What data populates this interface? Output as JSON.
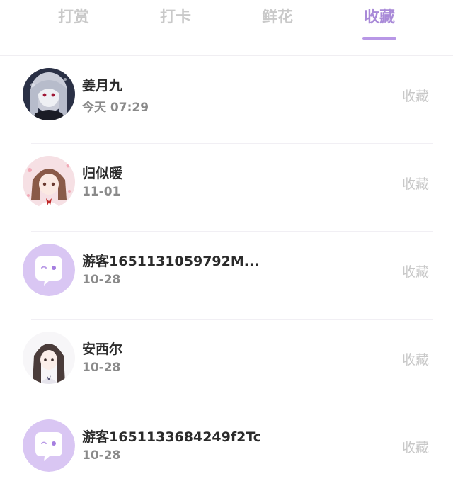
{
  "tabs": [
    {
      "label": "打赏",
      "active": false
    },
    {
      "label": "打卡",
      "active": false
    },
    {
      "label": "鲜花",
      "active": false
    },
    {
      "label": "收藏",
      "active": true
    }
  ],
  "colors": {
    "accent": "#b897e6",
    "inactive_tab": "#c9c9c9",
    "guest_avatar_bg": "#d9c6f3"
  },
  "rows": [
    {
      "name": "姜月九",
      "time": "今天 07:29",
      "action": "收藏",
      "avatar": "anime-girl-dark-avatar"
    },
    {
      "name": "归似暖",
      "time": "11-01",
      "action": "收藏",
      "avatar": "anime-girl-pink-avatar"
    },
    {
      "name": "游客1651131059792M...",
      "time": "10-28",
      "action": "收藏",
      "avatar": "guest-chat-bubble-avatar"
    },
    {
      "name": "安西尔",
      "time": "10-28",
      "action": "收藏",
      "avatar": "anime-girl-brown-hair-avatar"
    },
    {
      "name": "游客1651133684249f2Tc",
      "time": "10-28",
      "action": "收藏",
      "avatar": "guest-chat-bubble-avatar"
    }
  ]
}
